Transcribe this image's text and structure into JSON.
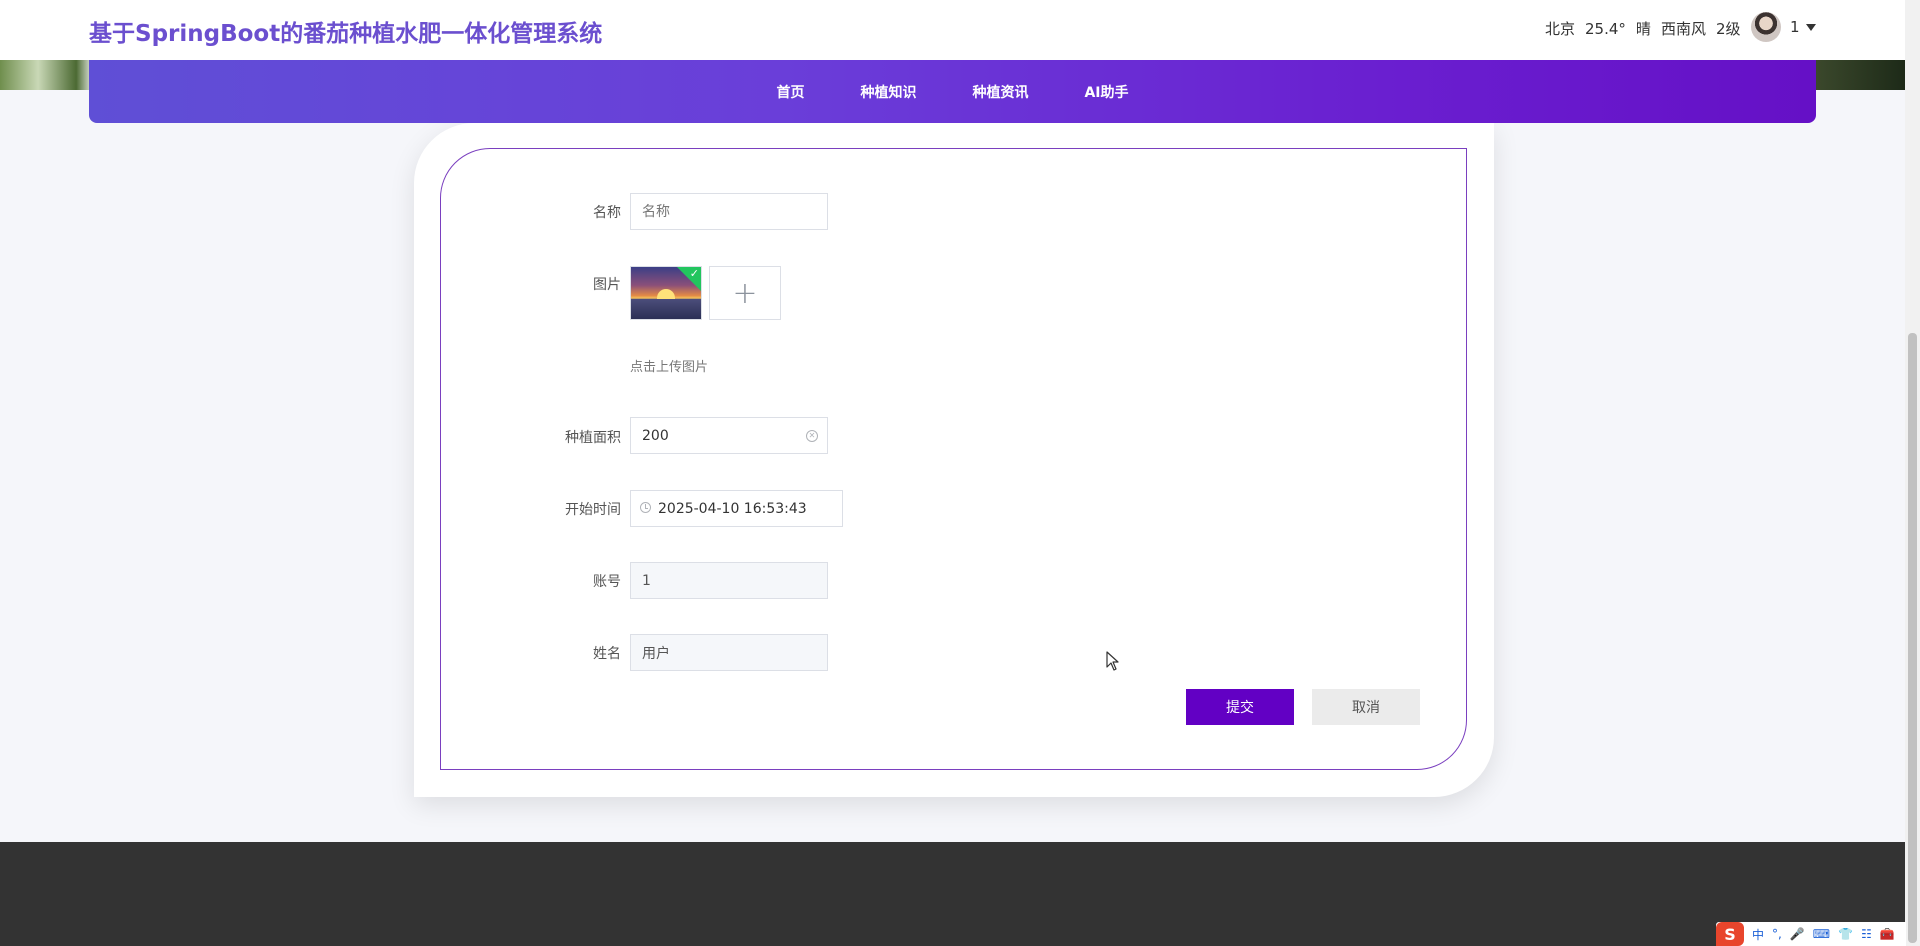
{
  "header": {
    "site_title": "基于SpringBoot的番茄种植水肥一体化管理系统",
    "weather": {
      "city": "北京",
      "temperature": "25.4°",
      "condition": "晴",
      "wind": "西南风",
      "level": "2级"
    },
    "user": "1"
  },
  "nav": {
    "items": [
      {
        "label": "首页"
      },
      {
        "label": "种植知识"
      },
      {
        "label": "种植资讯"
      },
      {
        "label": "AI助手"
      }
    ]
  },
  "form": {
    "name": {
      "label": "名称",
      "value": "",
      "placeholder": "名称"
    },
    "image": {
      "label": "图片",
      "hint": "点击上传图片",
      "uploaded": true
    },
    "area": {
      "label": "种植面积",
      "value": "200"
    },
    "start_time": {
      "label": "开始时间",
      "value": "2025-04-10 16:53:43"
    },
    "account": {
      "label": "账号",
      "value": "1"
    },
    "real_name": {
      "label": "姓名",
      "value": "用户"
    },
    "submit_label": "提交",
    "cancel_label": "取消"
  },
  "ime": {
    "logo": "S",
    "items": [
      "中",
      "°,",
      "🎤",
      "⌨",
      "👕",
      "☷",
      "🧰"
    ]
  },
  "colors": {
    "title": "#6b4fcf",
    "nav_start": "#5f4fd6",
    "nav_end": "#6510c6",
    "primary_button": "#6200c4",
    "footer": "#333333",
    "card_border": "#7a3fbf"
  }
}
